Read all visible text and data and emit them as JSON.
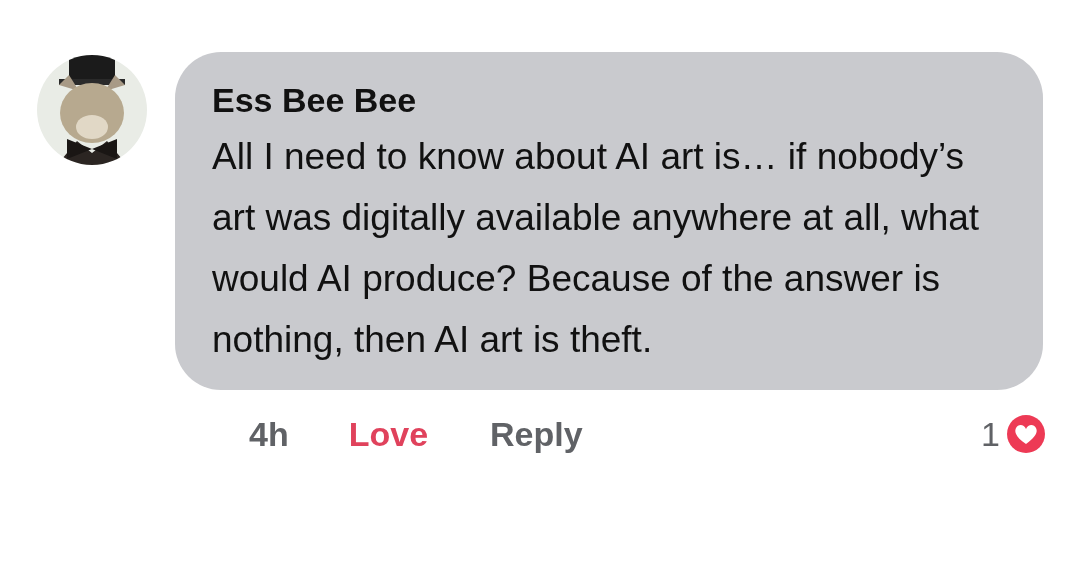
{
  "comment": {
    "author": "Ess Bee Bee",
    "text": "All I need to know about AI art is… if nobody’s art was digitally available anywhere at all, what would AI produce? Because of the answer is nothing, then AI art is theft.",
    "time": "4h",
    "reaction_button": {
      "label": "Love",
      "active": true
    },
    "reply": "Reply",
    "reaction_count": "1"
  }
}
